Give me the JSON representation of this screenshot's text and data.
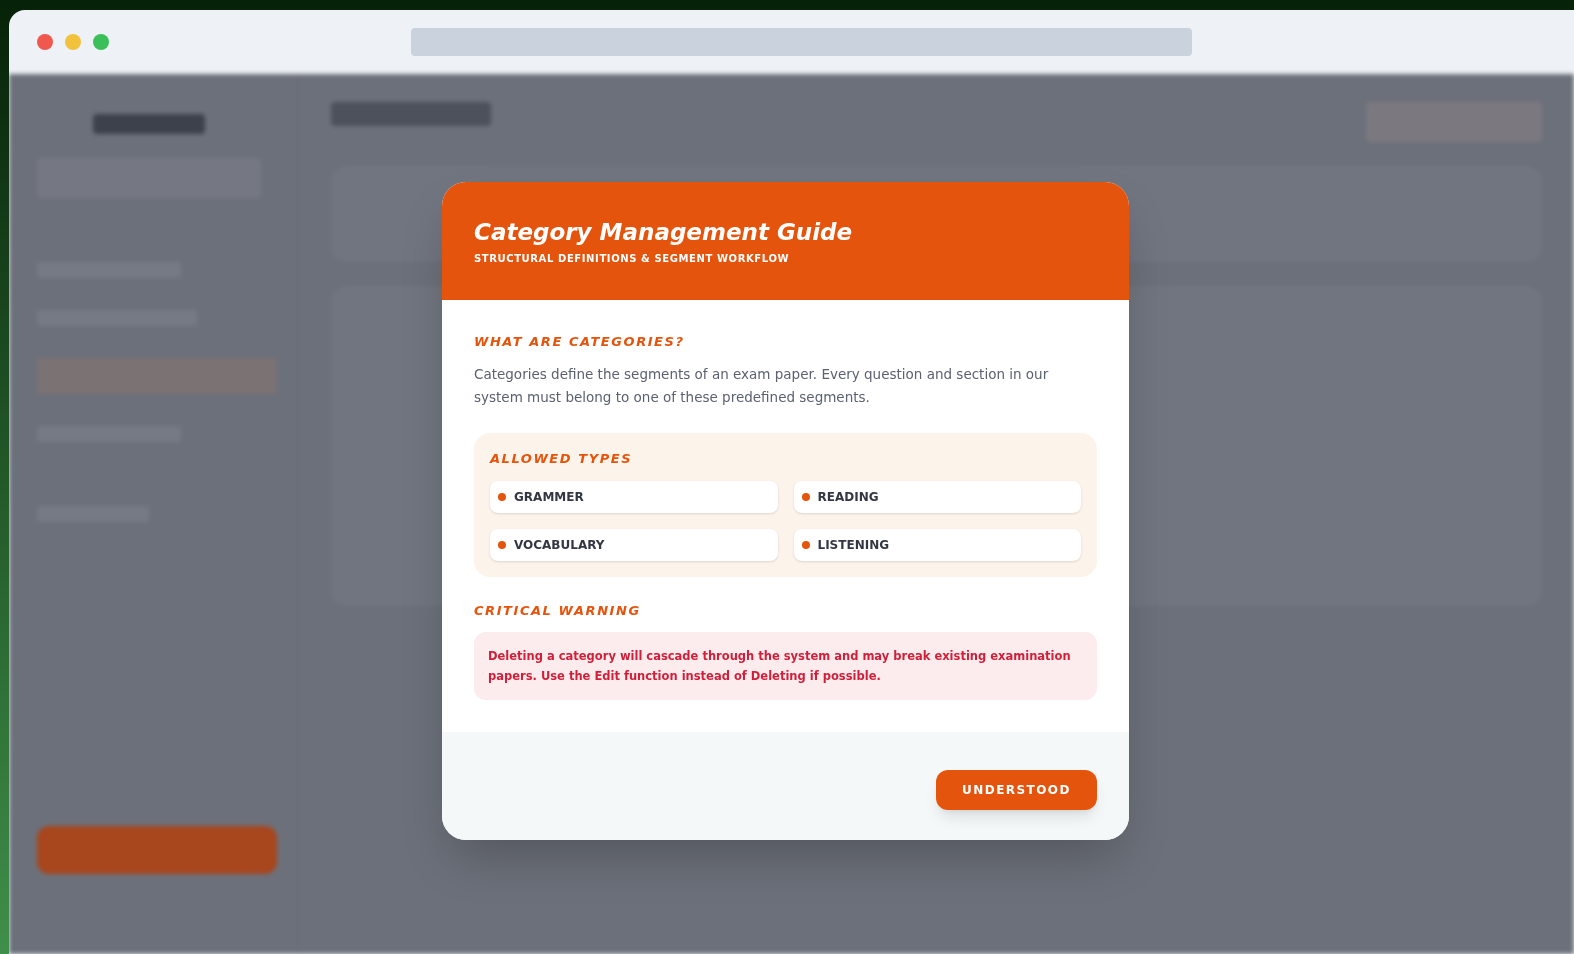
{
  "modal": {
    "title": "Category Management Guide",
    "subtitle": "STRUCTURAL DEFINITIONS & SEGMENT WORKFLOW",
    "intro_heading": "WHAT ARE CATEGORIES?",
    "intro_text": "Categories define the segments of an exam paper. Every question and section in our system must belong to one of these predefined segments.",
    "types_heading": "ALLOWED TYPES",
    "types": [
      "GRAMMER",
      "READING",
      "VOCABULARY",
      "LISTENING"
    ],
    "warning_heading": "CRITICAL WARNING",
    "warning_text": "Deleting a category will cascade through the system and may break existing examination papers. Use the Edit function instead of Deleting if possible.",
    "button": "UNDERSTOOD"
  }
}
